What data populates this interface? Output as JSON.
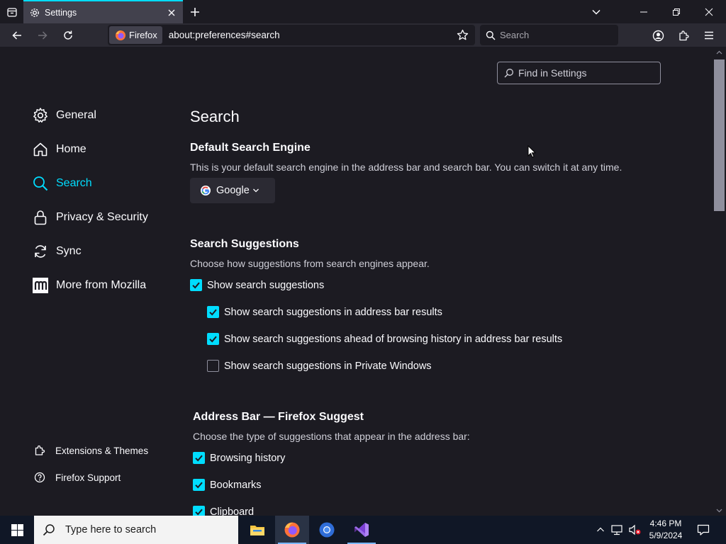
{
  "tab": {
    "title": "Settings"
  },
  "navbar": {
    "identity_label": "Firefox",
    "url": "about:preferences#search",
    "search_placeholder": "Search"
  },
  "find": {
    "placeholder": "Find in Settings"
  },
  "sidebar": {
    "categories": [
      {
        "label": "General",
        "icon": "gear-icon"
      },
      {
        "label": "Home",
        "icon": "home-icon"
      },
      {
        "label": "Search",
        "icon": "search-icon",
        "selected": true
      },
      {
        "label": "Privacy & Security",
        "icon": "lock-icon"
      },
      {
        "label": "Sync",
        "icon": "sync-icon"
      },
      {
        "label": "More from Mozilla",
        "icon": "mozilla-icon"
      }
    ],
    "footer": [
      {
        "label": "Extensions & Themes",
        "icon": "puzzle-icon"
      },
      {
        "label": "Firefox Support",
        "icon": "help-icon"
      }
    ]
  },
  "main": {
    "title": "Search",
    "default_engine": {
      "heading": "Default Search Engine",
      "description": "This is your default search engine in the address bar and search bar. You can switch it at any time.",
      "selected": "Google"
    },
    "suggestions": {
      "heading": "Search Suggestions",
      "description": "Choose how suggestions from search engines appear.",
      "items": [
        {
          "label": "Show search suggestions",
          "checked": true
        },
        {
          "label": "Show search suggestions in address bar results",
          "checked": true
        },
        {
          "label": "Show search suggestions ahead of browsing history in address bar results",
          "checked": true
        },
        {
          "label": "Show search suggestions in Private Windows",
          "checked": false
        }
      ]
    },
    "address_bar": {
      "heading": "Address Bar — Firefox Suggest",
      "description": "Choose the type of suggestions that appear in the address bar:",
      "items": [
        {
          "label": "Browsing history",
          "checked": true
        },
        {
          "label": "Bookmarks",
          "checked": true
        },
        {
          "label": "Clipboard",
          "checked": true
        }
      ]
    }
  },
  "taskbar": {
    "search_placeholder": "Type here to search",
    "time": "4:46 PM",
    "date": "5/9/2024"
  },
  "colors": {
    "accent": "#00ddff",
    "background": "#1c1b22",
    "toolbar": "#2b2a33"
  }
}
